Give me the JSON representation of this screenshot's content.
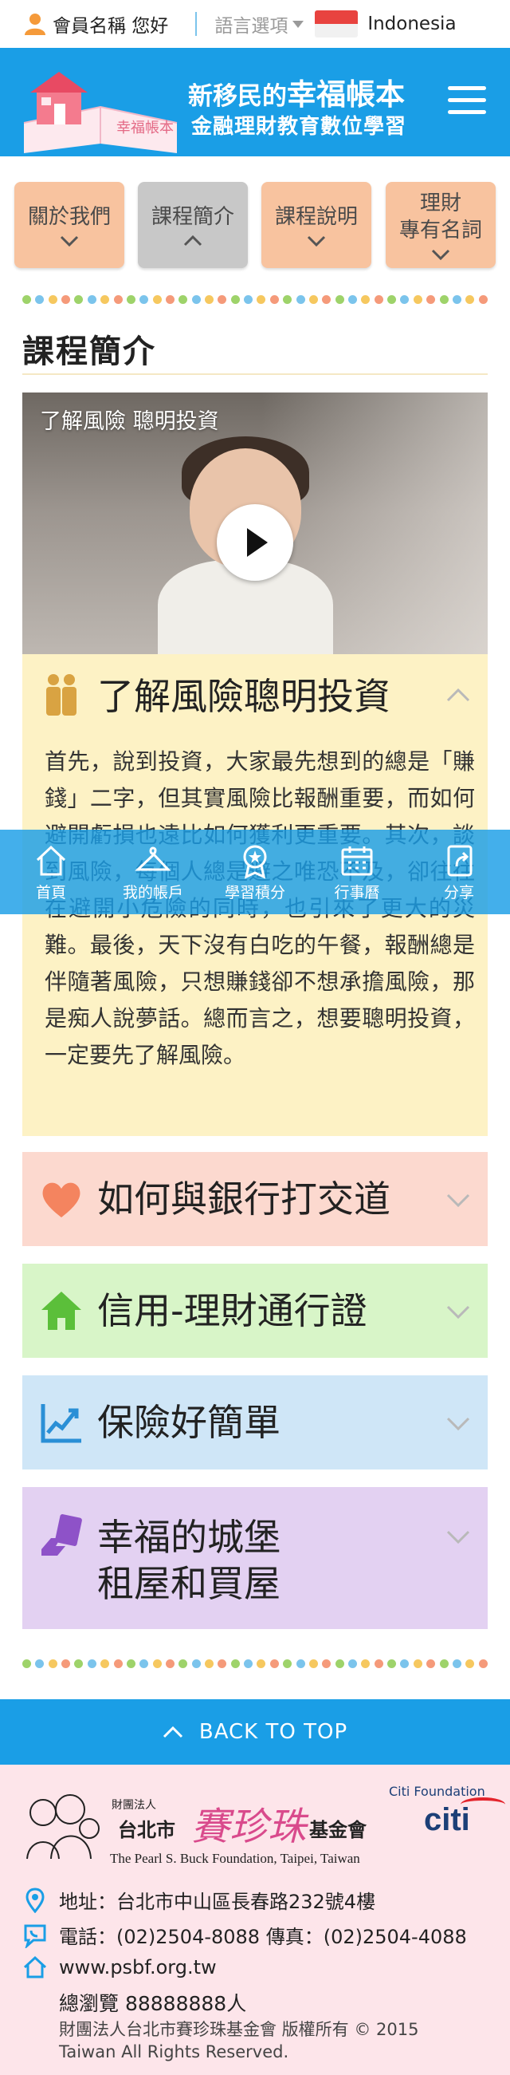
{
  "topbar": {
    "greeting": "會員名稱 您好",
    "language_label": "語言選項",
    "language_value": "Indonesia"
  },
  "header": {
    "title_prefix": "新移民的",
    "title_main": "幸福帳本",
    "subtitle": "金融理財教育數位學習",
    "logo_book_text": "幸福帳本"
  },
  "tabs": [
    {
      "label": "關於我們",
      "active": false
    },
    {
      "label": "課程簡介",
      "active": true
    },
    {
      "label": "課程說明",
      "active": false
    },
    {
      "label": "理財\n專有名詞",
      "active": false
    }
  ],
  "dot_colors": [
    "#9ed36a",
    "#7bc4ec",
    "#f6c85f",
    "#f59a7a"
  ],
  "section": {
    "title": "課程簡介"
  },
  "video": {
    "caption": "了解風險 聰明投資"
  },
  "accordion": [
    {
      "title": "了解風險聰明投資",
      "icon": "people-icon",
      "expanded": true,
      "bg": "#fdf2c5",
      "icon_color": "#d9a342",
      "body": "首先，說到投資，大家最先想到的總是「賺錢」二字，但其實風險比報酬重要，而如何避開虧損也遠比如何獲利更重要。其次，談到風險，每個人總是避之唯恐不及，卻往往在避開小危險的同時，也引來了更大的災難。最後，天下沒有白吃的午餐，報酬總是伴隨著風險，只想賺錢卻不想承擔風險，那是痴人說夢話。總而言之，想要聰明投資，一定要先了解風險。"
    },
    {
      "title": "如何與銀行打交道",
      "icon": "heart-icon",
      "expanded": false,
      "bg": "#fcd9cf",
      "icon_color": "#f4845f"
    },
    {
      "title": "信用-理財通行證",
      "icon": "home-icon",
      "expanded": false,
      "bg": "#d8f5c8",
      "icon_color": "#5bbf3a"
    },
    {
      "title": "保險好簡單",
      "icon": "chart-line-icon",
      "expanded": false,
      "bg": "#cfe6f7",
      "icon_color": "#2a8fd6"
    },
    {
      "title": "幸福的城堡\n租屋和買屋",
      "icon": "hand-card-icon",
      "expanded": false,
      "bg": "#e3d1f2",
      "icon_color": "#8e52c8"
    }
  ],
  "bottom_nav": [
    {
      "label": "首頁",
      "icon": "home-icon"
    },
    {
      "label": "我的帳戶",
      "icon": "hanger-icon"
    },
    {
      "label": "學習積分",
      "icon": "medal-icon"
    },
    {
      "label": "行事曆",
      "icon": "calendar-icon"
    },
    {
      "label": "分享",
      "icon": "share-icon"
    }
  ],
  "back_to_top": {
    "label": "BACK TO TOP"
  },
  "footer": {
    "foundation_prefix": "財團法人",
    "foundation_city": "台北市",
    "foundation_name": "賽珍珠",
    "foundation_suffix": "基金會",
    "foundation_en": "The Pearl S. Buck Foundation, Taipei, Taiwan",
    "citi_foundation": "Citi Foundation",
    "citi_logo": "citi",
    "address": "地址：台北市中山區長春路232號4樓",
    "phone": "電話：(02)2504-8088  傳真：(02)2504-4088",
    "website": "www.psbf.org.tw",
    "visits": "總瀏覽 88888888人",
    "copyright": "財團法人台北市賽珍珠基金會 版權所有 © 2015 Taiwan All Rights Reserved."
  },
  "colors": {
    "brand_blue": "#1a9ee6",
    "tab_orange": "#f8c39f",
    "tab_active": "#c8c8c8",
    "footer_pink": "#fde5ea"
  }
}
